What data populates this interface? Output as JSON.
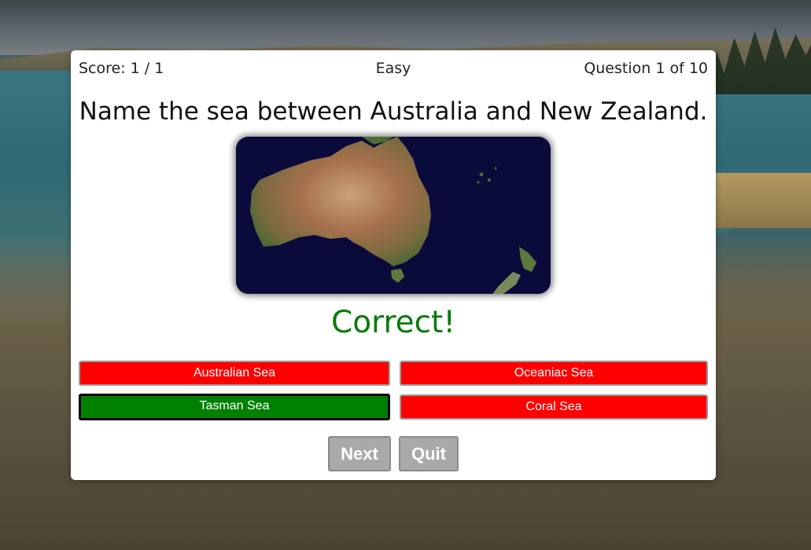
{
  "hud": {
    "score": "Score: 1 / 1",
    "difficulty": "Easy",
    "progress": "Question 1 of 10"
  },
  "question": {
    "text": "Name the sea between Australia and New Zealand."
  },
  "feedback": {
    "text": "Correct!",
    "color": "#0a7a0a"
  },
  "answers": [
    {
      "label": "Australian Sea",
      "state": "wrong"
    },
    {
      "label": "Oceaniac Sea",
      "state": "wrong"
    },
    {
      "label": "Tasman Sea",
      "state": "correct-selected"
    },
    {
      "label": "Coral Sea",
      "state": "wrong"
    }
  ],
  "controls": {
    "next_label": "Next",
    "quit_label": "Quit"
  },
  "colors": {
    "wrong": "#ff0000",
    "correct": "#008000",
    "control": "#a9a9a9"
  }
}
